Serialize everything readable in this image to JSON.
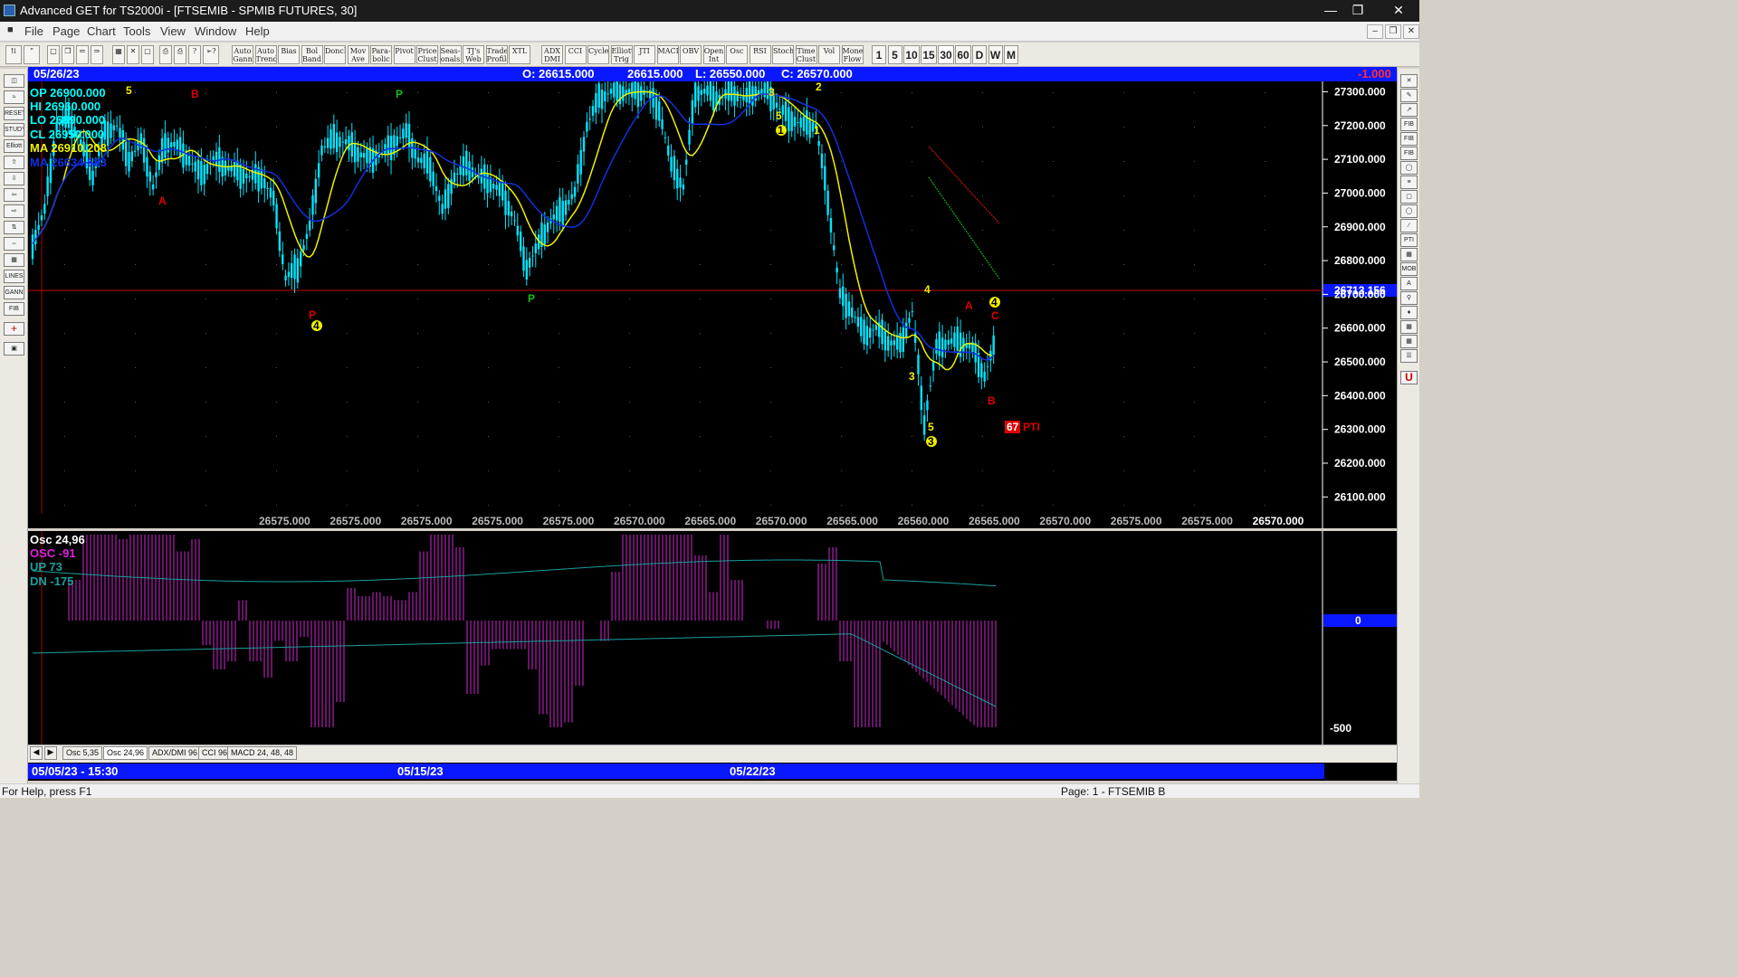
{
  "window": {
    "title": "Advanced GET for TS2000i - [FTSEMIB - SPMIB FUTURES, 30]"
  },
  "menu": [
    "File",
    "Page",
    "Chart",
    "Tools",
    "View",
    "Window",
    "Help"
  ],
  "toolbar": {
    "tools": [
      "Auto Gann",
      "Auto Trend",
      "Bias",
      "Bol Band",
      "Donch",
      "Mov Ave",
      "Para-bolic",
      "Pivot",
      "Price Clust",
      "Seas-onals",
      "TJ's Web",
      "Trade Profile",
      "XTL",
      "ADX DMI",
      "CCI",
      "Cycles",
      "Elliott Trig",
      "JTI",
      "MACD",
      "OBV",
      "Open Int",
      "Osc",
      "RSI",
      "Stoch",
      "Time Clust",
      "Vol",
      "Money Flow"
    ],
    "intervals": [
      "1",
      "5",
      "10",
      "15",
      "30",
      "60",
      "D",
      "W",
      "M"
    ],
    "active_interval": "30"
  },
  "infobar": {
    "date": "05/26/23",
    "open": "O: 26615.000",
    "high": "26615.000",
    "low": "L: 26550.000",
    "close": "C: 26570.000",
    "change": "-1.000"
  },
  "legend": {
    "op": "OP 26900.000",
    "hi": "HI  26960.000",
    "lo": "LO  26890.000",
    "cl": "CL  26950.000",
    "ma1": "MA  26910.208",
    "ma2": "MA  26634.583"
  },
  "price_axis": [
    "27300.000",
    "27200.000",
    "27100.000",
    "27000.000",
    "26900.000",
    "26800.000",
    "26700.000",
    "26600.000",
    "26500.000",
    "26400.000",
    "26300.000",
    "26200.000",
    "26100.000"
  ],
  "price_marker": "26713.156",
  "bottom_values": [
    "26575.000",
    "26575.000",
    "26575.000",
    "26575.000",
    "26575.000",
    "26570.000",
    "26565.000",
    "26570.000",
    "26565.000",
    "26560.000",
    "26565.000",
    "26570.000",
    "26575.000",
    "26575.000",
    "26570.000"
  ],
  "chart_labels": {
    "wave": [
      "5",
      "B",
      "P",
      "A",
      "P",
      "4",
      "P",
      "3",
      "5",
      "2",
      "1",
      "1",
      "4",
      "3",
      "5",
      "3",
      "A",
      "4",
      "C",
      "B"
    ],
    "pti_num": "67",
    "pti": "PTI"
  },
  "osc_legend": {
    "title": "Osc 24,96",
    "osc": "OSC -91",
    "up": "UP   73",
    "dn": "DN   -175"
  },
  "osc_axis": {
    "zero": "0",
    "neg": "-500"
  },
  "tabs": [
    "Osc 5,35",
    "Osc 24,96",
    "ADX/DMI 96",
    "CCI 96",
    "MACD 24, 48, 48"
  ],
  "active_tab": "Osc 24,96",
  "dates": [
    "05/05/23 - 15:30",
    "05/15/23",
    "05/22/23"
  ],
  "status": {
    "help": "For Help, press F1",
    "page": "Page: 1 - FTSEMIB B"
  },
  "chart_data": {
    "type": "line",
    "title": "",
    "ylim": [
      26050,
      27320
    ],
    "price": [
      26850,
      26950,
      27200,
      27220,
      27150,
      27050,
      27180,
      27200,
      27100,
      27150,
      27020,
      27150,
      27140,
      27100,
      27050,
      27100,
      27080,
      27060,
      27050,
      27050,
      26980,
      26750,
      26780,
      26900,
      27130,
      27160,
      27150,
      27120,
      27100,
      27120,
      27150,
      27180,
      27100,
      27080,
      26950,
      27050,
      27080,
      27050,
      27030,
      27000,
      26920,
      26780,
      26850,
      26920,
      26950,
      27000,
      27200,
      27280,
      27300,
      27300,
      27300,
      27300,
      27250,
      27080,
      27020,
      27300,
      27300,
      27280,
      27300,
      27280,
      27300,
      27300,
      27250,
      27220,
      27200,
      27200,
      26980,
      26700,
      26650,
      26580,
      26600,
      26560,
      26550,
      26650,
      26320,
      26540,
      26560,
      26560,
      26540,
      26460,
      26570
    ]
  }
}
